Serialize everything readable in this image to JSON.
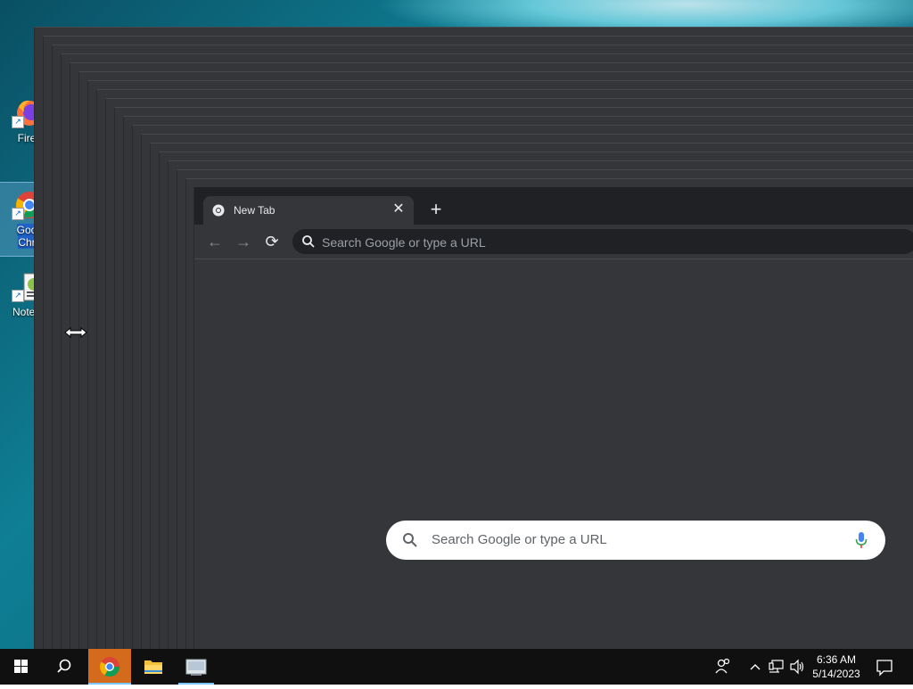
{
  "desktop": {
    "icons": [
      {
        "label": "Fire",
        "icon": "firefox-icon"
      },
      {
        "label_line1": "Goo",
        "label_line2": "Chr",
        "icon": "chrome-icon",
        "selected": true
      },
      {
        "label": "Notep",
        "icon": "notepad-icon"
      }
    ]
  },
  "browser": {
    "tab_title": "New Tab",
    "close_glyph": "✕",
    "new_tab_glyph": "+",
    "back_glyph": "←",
    "forward_glyph": "→",
    "reload_glyph": "⟳",
    "omnibox_placeholder": "Search Google or type a URL",
    "ntp_search_placeholder": "Search Google or type a URL",
    "theme": {
      "frame": "#202124",
      "toolbar": "#35363a",
      "text": "#e8eaed"
    }
  },
  "taskbar": {
    "time": "6:36 AM",
    "date": "5/14/2023",
    "active_app": "Google Chrome",
    "accent": "#d46a1c"
  }
}
